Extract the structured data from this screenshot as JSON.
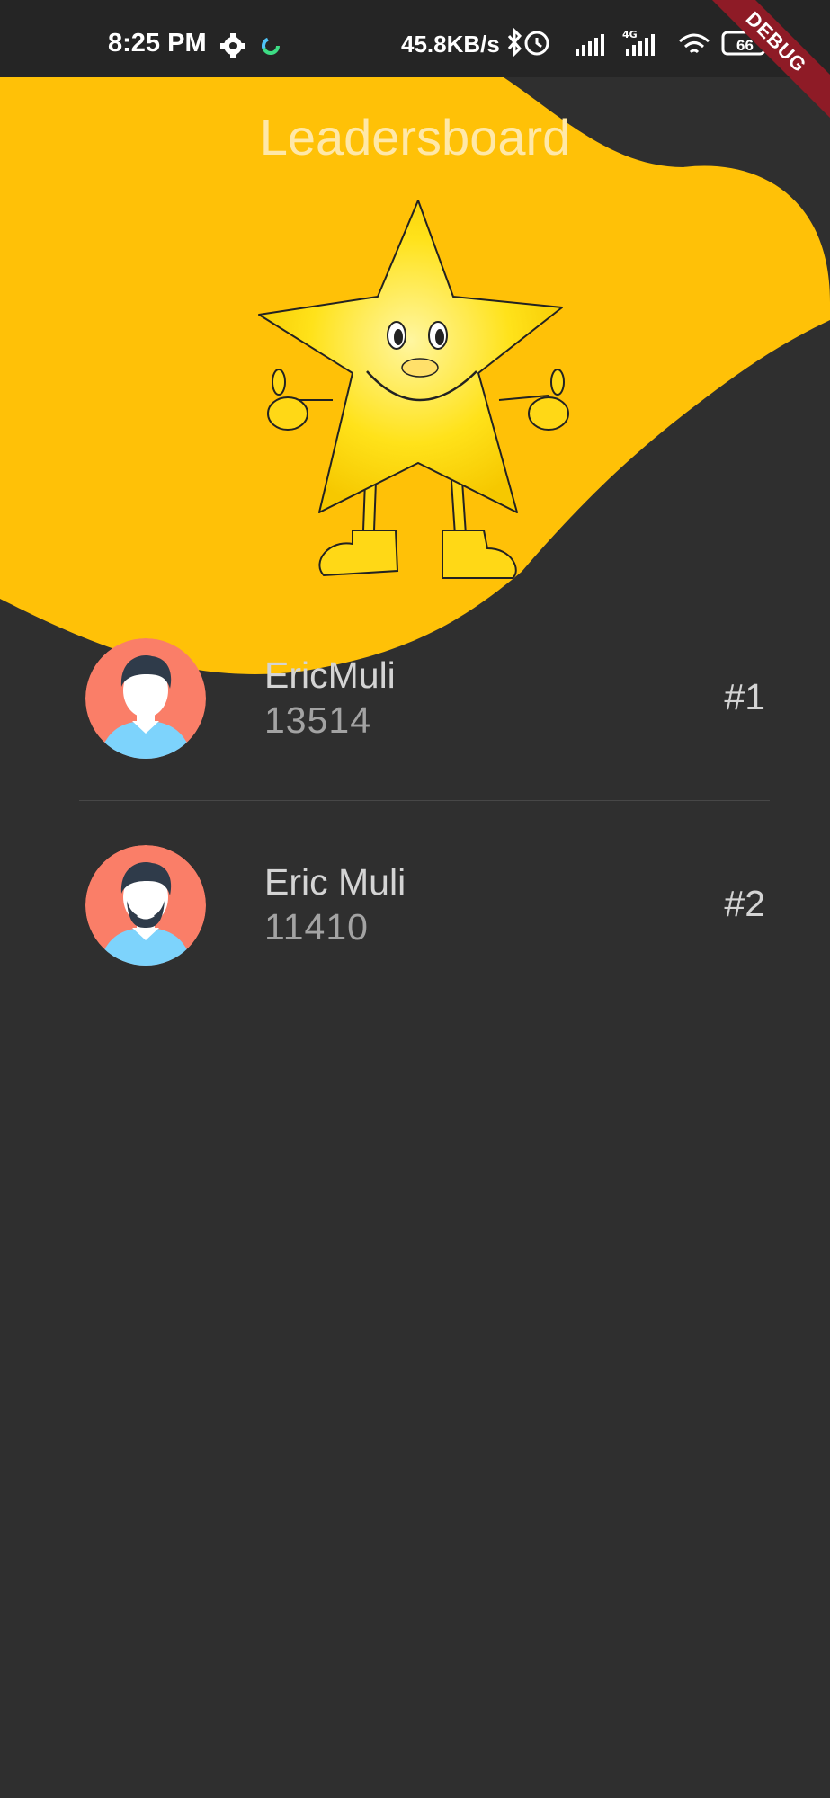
{
  "status_bar": {
    "time": "8:25 PM",
    "network_speed": "45.8KB/s",
    "battery_level": "66",
    "debug_label": "DEBUG",
    "icons": [
      "gear-icon",
      "activity-ring-icon",
      "bluetooth-icon",
      "alarm-icon",
      "signal-icon",
      "signal-4g-icon",
      "wifi-icon",
      "battery-icon"
    ]
  },
  "header": {
    "title": "Leadersboard",
    "colors": {
      "accent": "#FFC107",
      "background": "#2F2F2F"
    }
  },
  "leaders": [
    {
      "name": "EricMuli",
      "score": "13514",
      "rank": "#1"
    },
    {
      "name": "Eric Muli",
      "score": "11410",
      "rank": "#2"
    }
  ]
}
